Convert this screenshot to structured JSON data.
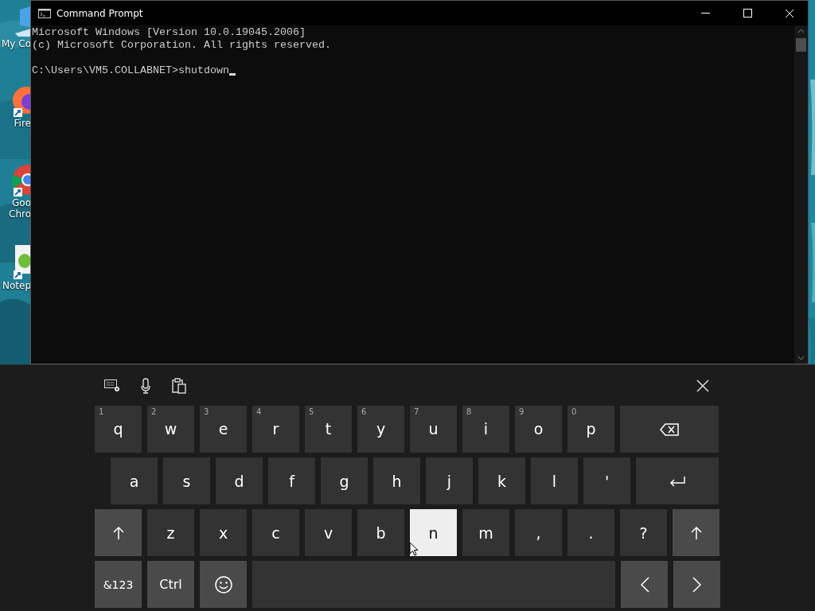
{
  "desktop_icons": [
    {
      "label": "My Co",
      "kind": "computer"
    },
    {
      "label": "Fire",
      "kind": "firefox"
    },
    {
      "label": "Goo\nChro",
      "kind": "chrome"
    },
    {
      "label": "Notep",
      "kind": "notepad"
    }
  ],
  "window": {
    "title": "Command Prompt",
    "output_lines": [
      "Microsoft Windows [Version 10.0.19045.2006]",
      "(c) Microsoft Corporation. All rights reserved."
    ],
    "command_line": "C:\\Users\\VM5.COLLABNET>shutdown"
  },
  "keyboard": {
    "rows": [
      [
        {
          "kind": "char",
          "label": "q",
          "hint": "1",
          "pressed": false
        },
        {
          "kind": "char",
          "label": "w",
          "hint": "2",
          "pressed": false
        },
        {
          "kind": "char",
          "label": "e",
          "hint": "3",
          "pressed": false
        },
        {
          "kind": "char",
          "label": "r",
          "hint": "4",
          "pressed": false
        },
        {
          "kind": "char",
          "label": "t",
          "hint": "5",
          "pressed": false
        },
        {
          "kind": "char",
          "label": "y",
          "hint": "6",
          "pressed": false
        },
        {
          "kind": "char",
          "label": "u",
          "hint": "7",
          "pressed": false
        },
        {
          "kind": "char",
          "label": "i",
          "hint": "8",
          "pressed": false
        },
        {
          "kind": "char",
          "label": "o",
          "hint": "9",
          "pressed": false
        },
        {
          "kind": "char",
          "label": "p",
          "hint": "0",
          "pressed": false
        },
        {
          "kind": "backspace",
          "pressed": false
        }
      ],
      [
        {
          "kind": "char",
          "label": "a",
          "pressed": false
        },
        {
          "kind": "char",
          "label": "s",
          "pressed": false
        },
        {
          "kind": "char",
          "label": "d",
          "pressed": false
        },
        {
          "kind": "char",
          "label": "f",
          "pressed": false
        },
        {
          "kind": "char",
          "label": "g",
          "pressed": false
        },
        {
          "kind": "char",
          "label": "h",
          "pressed": false
        },
        {
          "kind": "char",
          "label": "j",
          "pressed": false
        },
        {
          "kind": "char",
          "label": "k",
          "pressed": false
        },
        {
          "kind": "char",
          "label": "l",
          "pressed": false
        },
        {
          "kind": "char",
          "label": "'",
          "pressed": false
        },
        {
          "kind": "enter",
          "pressed": false
        }
      ],
      [
        {
          "kind": "shift",
          "pressed": false
        },
        {
          "kind": "char",
          "label": "z",
          "pressed": false
        },
        {
          "kind": "char",
          "label": "x",
          "pressed": false
        },
        {
          "kind": "char",
          "label": "c",
          "pressed": false
        },
        {
          "kind": "char",
          "label": "v",
          "pressed": false
        },
        {
          "kind": "char",
          "label": "b",
          "pressed": false
        },
        {
          "kind": "char",
          "label": "n",
          "pressed": true
        },
        {
          "kind": "char",
          "label": "m",
          "pressed": false
        },
        {
          "kind": "char",
          "label": ",",
          "pressed": false
        },
        {
          "kind": "char",
          "label": ".",
          "pressed": false
        },
        {
          "kind": "char",
          "label": "?",
          "pressed": false
        },
        {
          "kind": "shift",
          "pressed": false
        }
      ],
      [
        {
          "kind": "mode",
          "label": "&123",
          "pressed": false
        },
        {
          "kind": "mode",
          "label": "Ctrl",
          "pressed": false
        },
        {
          "kind": "emoji",
          "pressed": false
        },
        {
          "kind": "space",
          "pressed": false
        },
        {
          "kind": "left",
          "pressed": false
        },
        {
          "kind": "right",
          "pressed": false
        }
      ]
    ]
  }
}
